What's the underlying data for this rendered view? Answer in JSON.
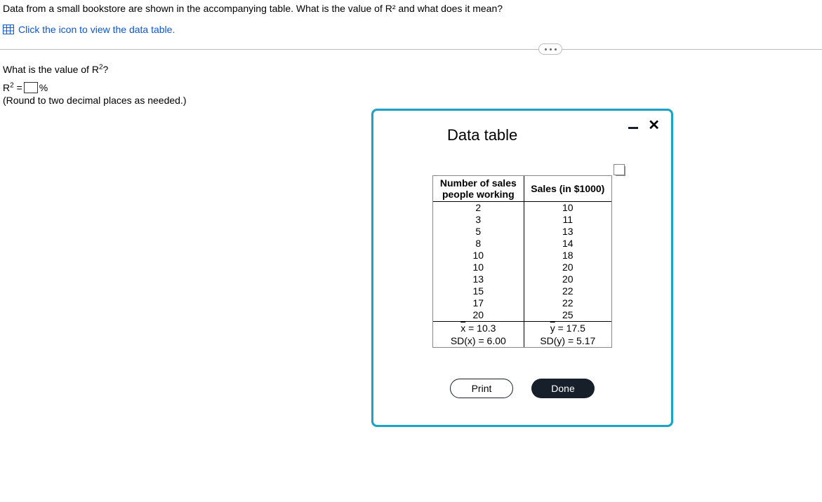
{
  "question": {
    "line1": "Data from a small bookstore are shown in the accompanying table. What is the value of R² and what does it mean?",
    "link_text": "Click the icon to view the data table.",
    "sub_question": "What is the value of R²?",
    "answer_prefix": "R² =",
    "answer_suffix": "%",
    "hint": "(Round to two decimal places as needed.)"
  },
  "dialog": {
    "title": "Data table",
    "headers": {
      "col1_line1": "Number of sales",
      "col1_line2": "people working",
      "col2": "Sales (in $1000)"
    },
    "rows": [
      {
        "x": "2",
        "y": "10"
      },
      {
        "x": "3",
        "y": "11"
      },
      {
        "x": "5",
        "y": "13"
      },
      {
        "x": "8",
        "y": "14"
      },
      {
        "x": "10",
        "y": "18"
      },
      {
        "x": "10",
        "y": "20"
      },
      {
        "x": "13",
        "y": "20"
      },
      {
        "x": "15",
        "y": "22"
      },
      {
        "x": "17",
        "y": "22"
      },
      {
        "x": "20",
        "y": "25"
      }
    ],
    "stats": {
      "xbar_label": "x̅ = 10.3",
      "ybar_label": "y̅ = 17.5",
      "sdx_label": "SD(x) = 6.00",
      "sdy_label": "SD(y) = 5.17"
    },
    "buttons": {
      "print": "Print",
      "done": "Done"
    }
  },
  "chart_data": {
    "type": "table",
    "title": "Data table",
    "columns": [
      "Number of sales people working",
      "Sales (in $1000)"
    ],
    "rows": [
      [
        2,
        10
      ],
      [
        3,
        11
      ],
      [
        5,
        13
      ],
      [
        8,
        14
      ],
      [
        10,
        18
      ],
      [
        10,
        20
      ],
      [
        13,
        20
      ],
      [
        15,
        22
      ],
      [
        17,
        22
      ],
      [
        20,
        25
      ]
    ],
    "summary": {
      "x_mean": 10.3,
      "y_mean": 17.5,
      "sd_x": 6.0,
      "sd_y": 5.17
    }
  }
}
